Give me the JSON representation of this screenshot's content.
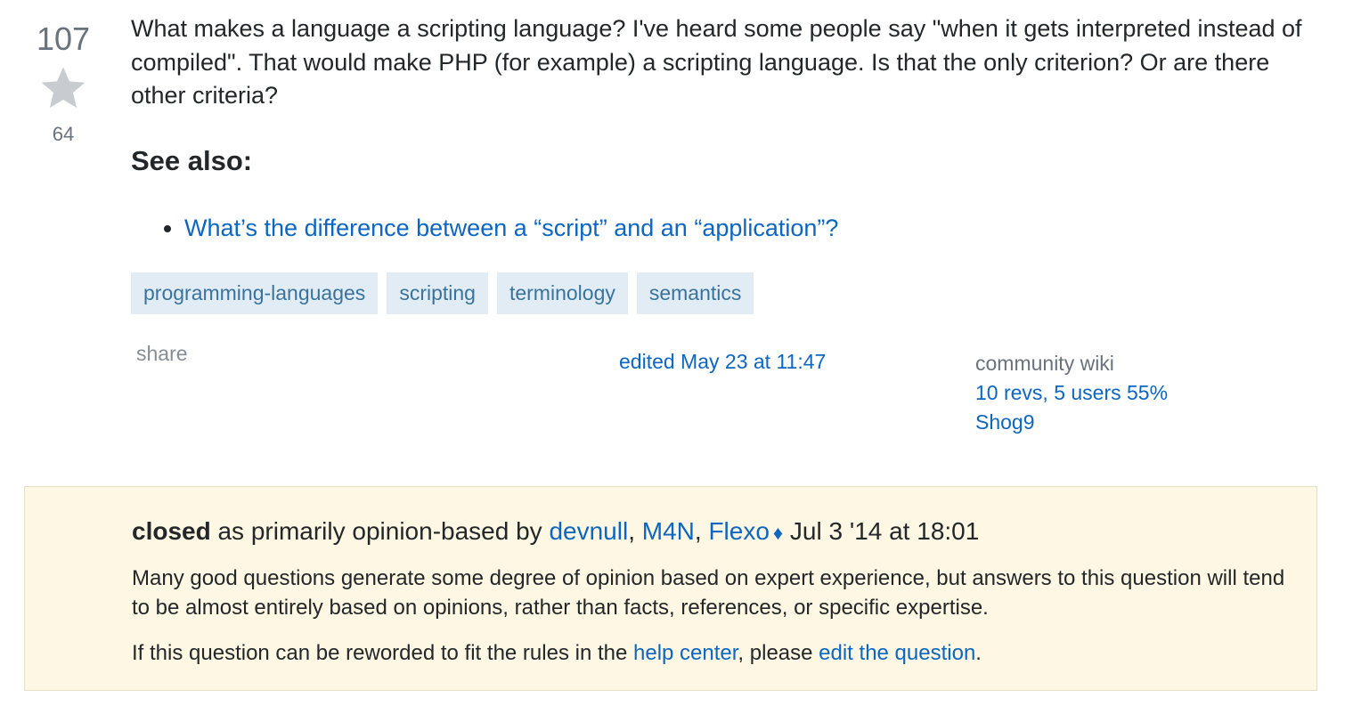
{
  "vote": {
    "score": "107",
    "favorite_count": "64"
  },
  "question": {
    "body": "What makes a language a scripting language? I've heard some people say \"when it gets interpreted instead of compiled\". That would make PHP (for example) a scripting language. Is that the only criterion? Or are there other criteria?",
    "see_also_heading": "See also:",
    "related_links": [
      {
        "label": "What’s the difference between a “script” and an “application”?"
      }
    ]
  },
  "tags": [
    "programming-languages",
    "scripting",
    "terminology",
    "semantics"
  ],
  "footer": {
    "share_label": "share",
    "edited_label": "edited May 23 at 11:47",
    "community_wiki_label": "community wiki",
    "revisions_label": "10 revs, 5 users 55%",
    "user_name": "Shog9"
  },
  "closed_notice": {
    "status_word": "closed",
    "reason_text": " as primarily opinion-based by ",
    "closers": [
      "devnull",
      "M4N",
      "Flexo"
    ],
    "separator": ", ",
    "moderator_symbol": "♦",
    "date": " Jul 3 '14 at 18:01",
    "description": "Many good questions generate some degree of opinion based on expert experience, but answers to this question will tend to be almost entirely based on opinions, rather than facts, references, or specific expertise.",
    "help_prefix": "If this question can be reworded to fit the rules in the ",
    "help_center_link": "help center",
    "help_middle": ", please ",
    "edit_link": "edit the question",
    "help_suffix": "."
  },
  "colors": {
    "link": "#0c66c2",
    "tag_bg": "#e1ecf4",
    "tag_text": "#39739d",
    "notice_bg": "#fdf7e3",
    "muted": "#6a737c"
  },
  "icons": {
    "favorite": "star-icon"
  }
}
